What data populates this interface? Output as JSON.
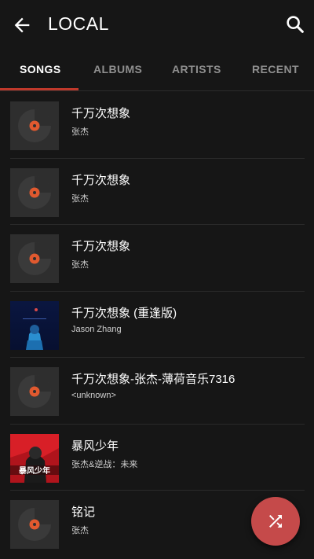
{
  "appbar": {
    "title": "LOCAL"
  },
  "tabs": [
    {
      "label": "SONGS",
      "active": true
    },
    {
      "label": "ALBUMS",
      "active": false
    },
    {
      "label": "ARTISTS",
      "active": false
    },
    {
      "label": "RECENT",
      "active": false
    }
  ],
  "songs": [
    {
      "title": "千万次想象",
      "artist": "张杰",
      "art": "disc-icon"
    },
    {
      "title": "千万次想象",
      "artist": "张杰",
      "art": "disc-icon"
    },
    {
      "title": "千万次想象",
      "artist": "张杰",
      "art": "disc-icon"
    },
    {
      "title": "千万次想象 (重逢版)",
      "artist": "Jason Zhang",
      "art": "album-cover"
    },
    {
      "title": "千万次想象-张杰-薄荷音乐7316",
      "artist": "<unknown>",
      "art": "disc-icon"
    },
    {
      "title": "暴风少年",
      "artist": "张杰&逆战：未来",
      "art": "album-cover",
      "cover_text": "暴风少年"
    },
    {
      "title": "铭记",
      "artist": "张杰",
      "art": "disc-icon"
    }
  ],
  "colors": {
    "accent": "#c0392b",
    "fab": "#c54a4a",
    "disc": "#e0592f"
  },
  "icons": {
    "back": "arrow-left-icon",
    "search": "search-icon",
    "fab": "shuffle-icon"
  }
}
